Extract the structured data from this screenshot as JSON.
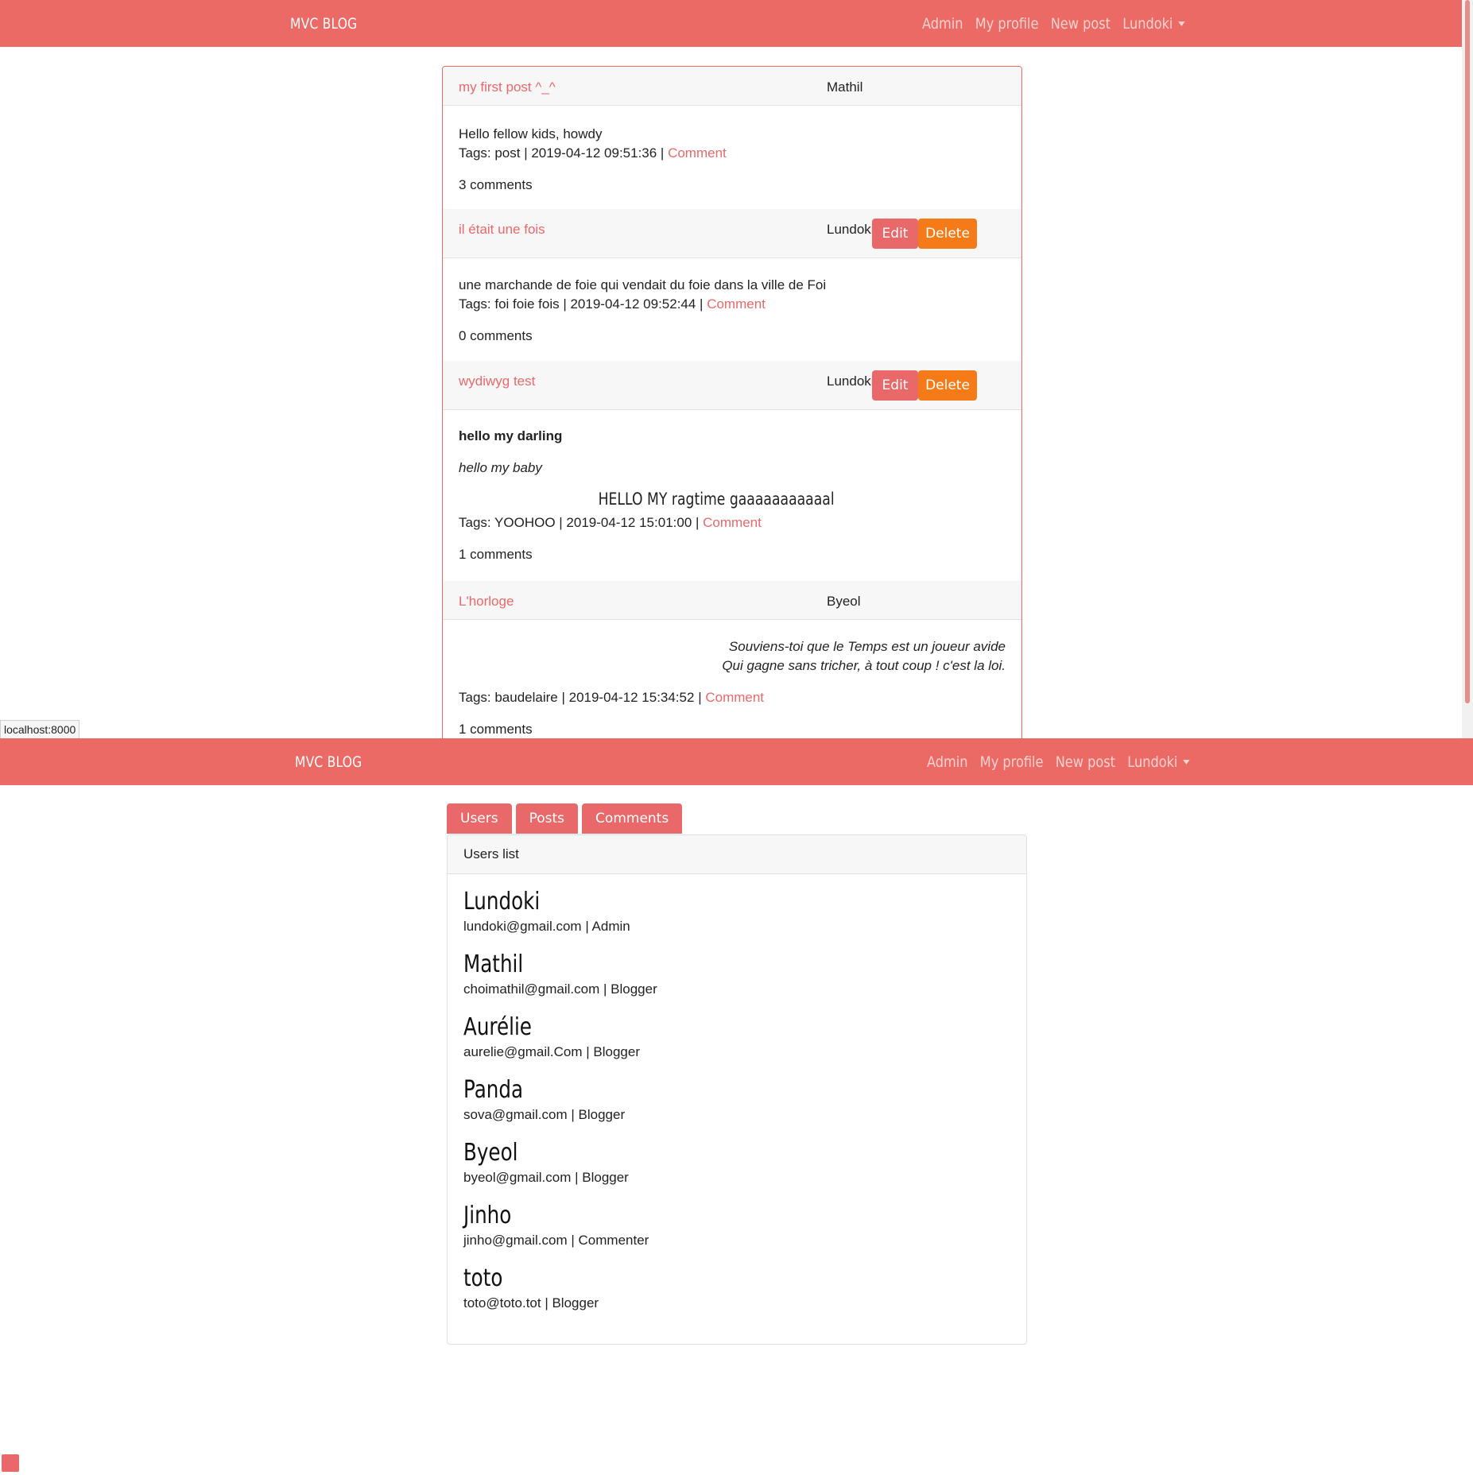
{
  "navbar": {
    "brand": "MVC BLOG",
    "links": [
      "Admin",
      "My profile",
      "New post"
    ],
    "user_menu": "Lundoki",
    "color": "#ec6a66"
  },
  "posts": [
    {
      "title": "my first post ^_^",
      "author": "Mathil",
      "content": [
        "Hello fellow kids, howdy"
      ],
      "meta": "Tags: post | 2019-04-12 09:51:36 | ",
      "comment_link": "Comment",
      "comments": "3 comments"
    },
    {
      "title": "il était une fois",
      "author": "Lundoki",
      "edit_label": "Edit",
      "delete_label": "Delete",
      "content": [
        "une marchande de foie qui vendait du foie dans la ville de Foi"
      ],
      "meta": "Tags: foi foie fois | 2019-04-12 09:52:44 | ",
      "comment_link": "Comment",
      "comments": "0 comments"
    },
    {
      "title": "wydiwyg test",
      "author": "Lundoki",
      "edit_label": "Edit",
      "delete_label": "Delete",
      "content_bold": "hello my darling",
      "content_italic": "hello my baby",
      "content_heading": "HELLO MY ragtime gaaaaaaaaaaal",
      "meta": "Tags: YOOHOO | 2019-04-12 15:01:00 | ",
      "comment_link": "Comment",
      "comments": "1 comments"
    },
    {
      "title": "L'horloge",
      "author": "Byeol",
      "content": [
        "Souviens-toi que le Temps est un joueur avide",
        "Qui gagne sans tricher, à tout coup ! c'est la loi."
      ],
      "meta": "Tags: baudelaire | 2019-04-12 15:34:52 | ",
      "comment_link": "Comment",
      "comments": "1 comments"
    }
  ],
  "status_url": "localhost:8000",
  "admin": {
    "tabs": [
      "Users",
      "Posts",
      "Comments"
    ],
    "panel_title": "Users list",
    "users": [
      {
        "name": "Lundoki",
        "email": "lundoki@gmail.com",
        "role": "Admin"
      },
      {
        "name": "Mathil",
        "email": "choimathil@gmail.com",
        "role": "Blogger"
      },
      {
        "name": "Aurélie",
        "email": "aurelie@gmail.Com",
        "role": "Blogger"
      },
      {
        "name": "Panda",
        "email": "sova@gmail.com",
        "role": "Blogger"
      },
      {
        "name": "Byeol",
        "email": "byeol@gmail.com",
        "role": "Blogger"
      },
      {
        "name": "Jinho",
        "email": "jinho@gmail.com",
        "role": "Commenter"
      },
      {
        "name": "toto",
        "email": "toto@toto.tot",
        "role": "Blogger"
      }
    ]
  }
}
